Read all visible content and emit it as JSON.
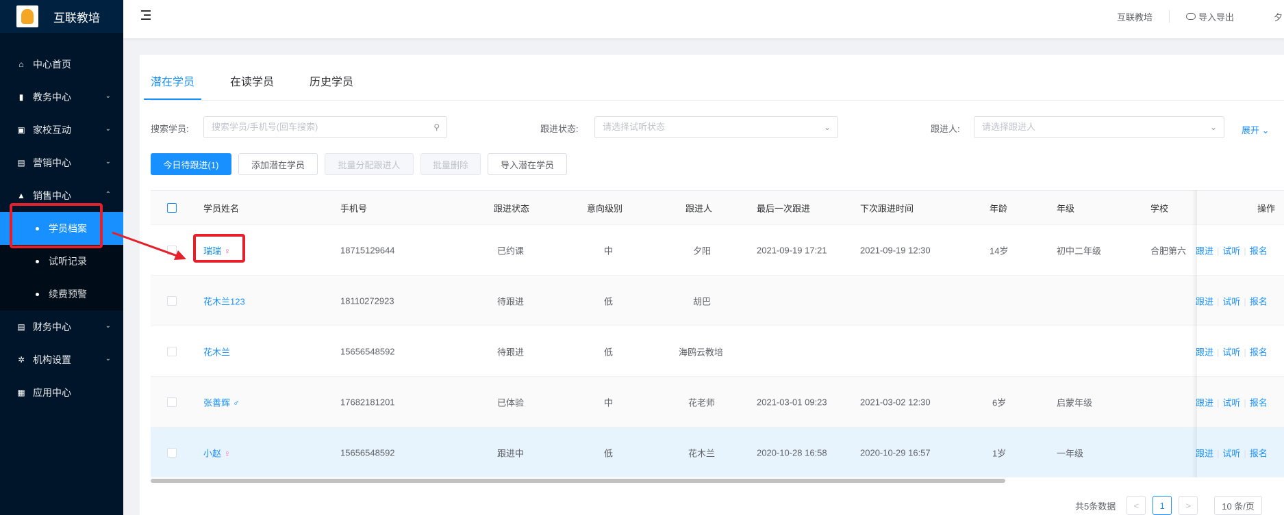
{
  "app": {
    "brand": "互联教培"
  },
  "sidebar": {
    "items": [
      {
        "label": "中心首页",
        "icon": "home-icon"
      },
      {
        "label": "教务中心",
        "icon": "book-icon"
      },
      {
        "label": "家校互动",
        "icon": "chat-icon"
      },
      {
        "label": "营销中心",
        "icon": "bag-icon"
      },
      {
        "label": "销售中心",
        "icon": "person-icon"
      },
      {
        "label": "财务中心",
        "icon": "wallet-icon"
      },
      {
        "label": "机构设置",
        "icon": "gear-icon"
      },
      {
        "label": "应用中心",
        "icon": "grid-icon"
      }
    ],
    "sales_sub": [
      "学员档案",
      "试听记录",
      "续费预警"
    ]
  },
  "header": {
    "org": "互联教培",
    "import_export": "导入导出",
    "cut_text": "夕"
  },
  "tabs": [
    "潜在学员",
    "在读学员",
    "历史学员"
  ],
  "filters": {
    "search_label": "搜索学员:",
    "search_placeholder": "搜索学员/手机号(回车搜索)",
    "status_label": "跟进状态:",
    "status_placeholder": "请选择试听状态",
    "follower_label": "跟进人:",
    "follower_placeholder": "请选择跟进人",
    "expand": "展开"
  },
  "toolbar": [
    "今日待跟进(1)",
    "添加潜在学员",
    "批量分配跟进人",
    "批量删除",
    "导入潜在学员"
  ],
  "table": {
    "headers": [
      "学员姓名",
      "手机号",
      "跟进状态",
      "意向级别",
      "跟进人",
      "最后一次跟进",
      "下次跟进时间",
      "年龄",
      "年级",
      "学校",
      "操作"
    ],
    "rows": [
      {
        "name": "瑞瑞",
        "gender": "♀",
        "phone": "18715129644",
        "status": "已约课",
        "level": "中",
        "follower": "夕阳",
        "last": "2021-09-19 17:21",
        "next": "2021-09-19 12:30",
        "age": "14岁",
        "grade": "初中二年级",
        "school": "合肥第六"
      },
      {
        "name": "花木兰123",
        "gender": "",
        "phone": "18110272923",
        "status": "待跟进",
        "level": "低",
        "follower": "胡巴",
        "last": "",
        "next": "",
        "age": "",
        "grade": "",
        "school": ""
      },
      {
        "name": "花木兰",
        "gender": "",
        "phone": "15656548592",
        "status": "待跟进",
        "level": "低",
        "follower": "海鸥云教培",
        "last": "",
        "next": "",
        "age": "",
        "grade": "",
        "school": ""
      },
      {
        "name": "张善辉",
        "gender": "♂",
        "phone": "17682181201",
        "status": "已体验",
        "level": "中",
        "follower": "花老师",
        "last": "2021-03-01 09:23",
        "next": "2021-03-02 12:30",
        "age": "6岁",
        "grade": "启蒙年级",
        "school": ""
      },
      {
        "name": "小赵",
        "gender": "♀",
        "phone": "15656548592",
        "status": "跟进中",
        "level": "低",
        "follower": "花木兰",
        "last": "2020-10-28 16:58",
        "next": "2020-10-29 16:57",
        "age": "1岁",
        "grade": "一年级",
        "school": ""
      }
    ],
    "ops": [
      "跟进",
      "试听",
      "报名"
    ]
  },
  "pagination": {
    "total": "共5条数据",
    "prev": "<",
    "page": "1",
    "next": ">",
    "size": "10 条/页"
  },
  "colors": {
    "accent": "#1890ff",
    "sidebar": "#001529",
    "annotation": "#e5202a"
  }
}
